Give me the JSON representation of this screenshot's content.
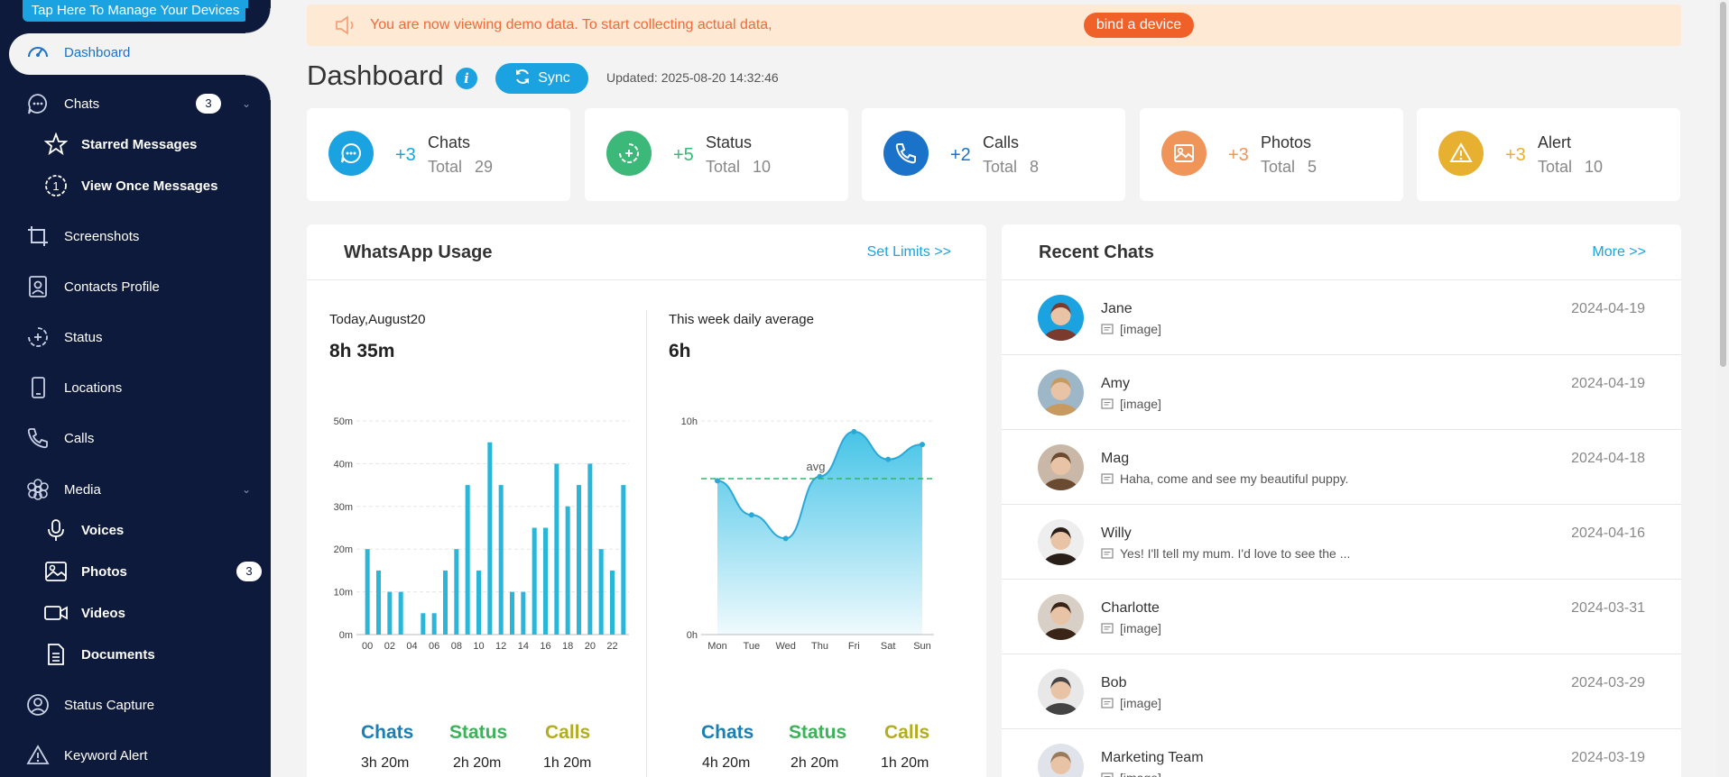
{
  "sidebar": {
    "tap_button": "Tap Here To Manage Your Devices",
    "items": [
      {
        "label": "Dashboard"
      },
      {
        "label": "Chats",
        "badge": "3"
      },
      {
        "label": "Starred Messages"
      },
      {
        "label": "View Once Messages"
      },
      {
        "label": "Screenshots"
      },
      {
        "label": "Contacts Profile"
      },
      {
        "label": "Status"
      },
      {
        "label": "Locations"
      },
      {
        "label": "Calls"
      },
      {
        "label": "Media"
      },
      {
        "label": "Voices"
      },
      {
        "label": "Photos",
        "badge": "3"
      },
      {
        "label": "Videos"
      },
      {
        "label": "Documents"
      },
      {
        "label": "Status Capture"
      },
      {
        "label": "Keyword Alert"
      }
    ]
  },
  "banner": {
    "text": "You are now viewing demo data. To start collecting actual data,",
    "button": "bind a device"
  },
  "header": {
    "title": "Dashboard",
    "sync": "Sync",
    "updated": "Updated: 2025-08-20 14:32:46"
  },
  "stats": [
    {
      "name": "Chats",
      "delta": "+3",
      "total_label": "Total",
      "total": "29",
      "color": "#1aa3e0"
    },
    {
      "name": "Status",
      "delta": "+5",
      "total_label": "Total",
      "total": "10",
      "color": "#3cb878"
    },
    {
      "name": "Calls",
      "delta": "+2",
      "total_label": "Total",
      "total": "8",
      "color": "#1a73c8"
    },
    {
      "name": "Photos",
      "delta": "+3",
      "total_label": "Total",
      "total": "5",
      "color": "#f0955a"
    },
    {
      "name": "Alert",
      "delta": "+3",
      "total_label": "Total",
      "total": "10",
      "color": "#e8b030"
    }
  ],
  "usage": {
    "title": "WhatsApp Usage",
    "link": "Set Limits >>",
    "today": {
      "label": "Today,August20",
      "time": "8h 35m",
      "legend": [
        {
          "name": "Chats",
          "value": "3h 20m"
        },
        {
          "name": "Status",
          "value": "2h 20m"
        },
        {
          "name": "Calls",
          "value": "1h 20m"
        }
      ]
    },
    "week": {
      "label": "This week daily average",
      "time": "6h",
      "legend": [
        {
          "name": "Chats",
          "value": "4h 20m"
        },
        {
          "name": "Status",
          "value": "2h 20m"
        },
        {
          "name": "Calls",
          "value": "1h 20m"
        }
      ]
    }
  },
  "chart_data": [
    {
      "type": "bar",
      "x": [
        "00",
        "01",
        "02",
        "03",
        "04",
        "05",
        "06",
        "07",
        "08",
        "09",
        "10",
        "11",
        "12",
        "13",
        "14",
        "15",
        "16",
        "17",
        "18",
        "19",
        "20",
        "21",
        "22",
        "23"
      ],
      "tick_labels": [
        "00",
        "02",
        "04",
        "06",
        "08",
        "10",
        "12",
        "14",
        "16",
        "18",
        "20",
        "22"
      ],
      "values": [
        20,
        15,
        10,
        10,
        0,
        5,
        5,
        15,
        20,
        35,
        15,
        45,
        35,
        10,
        10,
        25,
        25,
        40,
        30,
        35,
        40,
        20,
        15,
        35
      ],
      "y_ticks": [
        "0m",
        "10m",
        "20m",
        "30m",
        "40m",
        "50m"
      ],
      "ylim": [
        0,
        50
      ],
      "color": "#29b6d9"
    },
    {
      "type": "area",
      "categories": [
        "Mon",
        "Tue",
        "Wed",
        "Thu",
        "Fri",
        "Sat",
        "Sun"
      ],
      "values": [
        7.2,
        5.6,
        4.5,
        7.4,
        9.5,
        8.2,
        8.9
      ],
      "y_ticks": [
        "0h",
        "10h"
      ],
      "ylim": [
        0,
        10
      ],
      "avg_label": "avg",
      "avg": 7.3,
      "color": "#3dc1e6"
    }
  ],
  "recent": {
    "title": "Recent Chats",
    "link": "More >>",
    "chats": [
      {
        "name": "Jane",
        "msg": "[image]",
        "date": "2024-04-19"
      },
      {
        "name": "Amy",
        "msg": "[image]",
        "date": "2024-04-19"
      },
      {
        "name": "Mag",
        "msg": "Haha, come and see my beautiful puppy.",
        "date": "2024-04-18"
      },
      {
        "name": "Willy",
        "msg": "Yes! I'll tell my mum. I'd love to see the ...",
        "date": "2024-04-16"
      },
      {
        "name": "Charlotte",
        "msg": "[image]",
        "date": "2024-03-31"
      },
      {
        "name": "Bob",
        "msg": "[image]",
        "date": "2024-03-29"
      },
      {
        "name": "Marketing Team",
        "msg": "[image]",
        "date": "2024-03-19"
      }
    ]
  }
}
